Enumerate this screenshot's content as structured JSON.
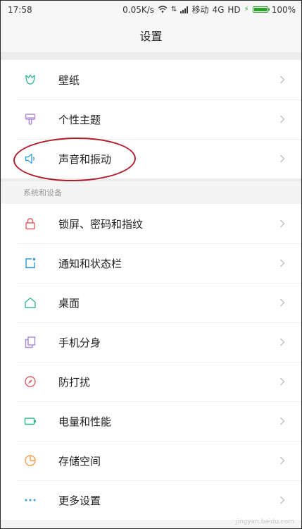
{
  "status_bar": {
    "time": "17:58",
    "speed": "0.05K/s",
    "carrier": "移动",
    "network": "4G",
    "hd": "HD",
    "battery": "100%"
  },
  "header": {
    "title": "设置"
  },
  "group1": {
    "items": [
      {
        "label": "壁纸",
        "icon": "wallpaper-icon",
        "color": "#37b8a4"
      },
      {
        "label": "个性主题",
        "icon": "theme-brush-icon",
        "color": "#b58ad0"
      },
      {
        "label": "声音和振动",
        "icon": "speaker-icon",
        "color": "#3a9fe0"
      }
    ]
  },
  "section_system": {
    "title": "系统和设备"
  },
  "group2": {
    "items": [
      {
        "label": "锁屏、密码和指纹",
        "icon": "lock-icon",
        "color": "#e0606a"
      },
      {
        "label": "通知和状态栏",
        "icon": "notification-icon",
        "color": "#2f9ad6"
      },
      {
        "label": "桌面",
        "icon": "home-icon",
        "color": "#3bb88e"
      },
      {
        "label": "手机分身",
        "icon": "dual-space-icon",
        "color": "#a98ad6"
      },
      {
        "label": "防打扰",
        "icon": "do-not-disturb-icon",
        "color": "#e0606a"
      },
      {
        "label": "电量和性能",
        "icon": "battery-icon",
        "color": "#2fb58a"
      },
      {
        "label": "存储空间",
        "icon": "storage-pie-icon",
        "color": "#f0a050"
      },
      {
        "label": "更多设置",
        "icon": "more-dots-icon",
        "color": "#3a9fe0"
      }
    ]
  },
  "watermark": "jingyan.baidu.com"
}
